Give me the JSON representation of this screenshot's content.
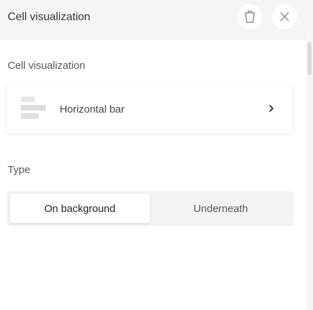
{
  "header": {
    "title": "Cell visualization",
    "delete_icon": "trash-icon",
    "close_icon": "close-icon"
  },
  "sections": {
    "visualization_label": "Cell visualization",
    "type_label": "Type"
  },
  "visualization": {
    "selected": "Horizontal bar",
    "icon": "horizontal-bar-chart-icon"
  },
  "type_options": {
    "options": [
      "On background",
      "Underneath"
    ],
    "selected": "On background"
  }
}
